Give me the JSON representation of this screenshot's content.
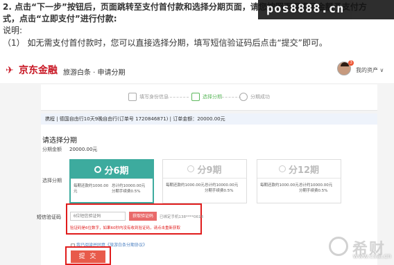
{
  "doc": {
    "line1": "2.   点击“下一步”按钮后，页面跳转至支付首付款和选择分期页面，请您按照页面提示金额予支付方",
    "line2": "式，点击“立即支付”进行付款:",
    "label": "说明:",
    "note": "（1）   如无需支付首付款时，您可以直接选择分期，填写短信验证码后点击“提交”即可。",
    "watermark": "pos8888.cn"
  },
  "header": {
    "logo_glyph": "✈",
    "brand": "京东金融",
    "subtitle": "旅游白条 · 申请分期",
    "badge": "3",
    "my_account": "我的资产 ∨"
  },
  "steps": [
    {
      "label": "填写身份信息"
    },
    {
      "label": "选择分期"
    },
    {
      "label": "分期成功"
    }
  ],
  "order": {
    "text": "携程 | 德国自由行10天9晚自由行(订单号 1720846871) | 订单金额：20000.00元"
  },
  "plan": {
    "section_title": "请选择分期",
    "amount_label": "分期金额",
    "amount_value": "20000.00元",
    "choose_label": "选择分期",
    "options": [
      {
        "label": "分6期",
        "monthly": "每期还款约1000.00元",
        "total": "总计约10000.00元",
        "fee": "分期手续费0.5%"
      },
      {
        "label": "分9期",
        "monthly": "每期还款约1000.00元",
        "total": "总计约10000.00元",
        "fee": "分期手续费0.5%"
      },
      {
        "label": "分12期",
        "monthly": "每期还款约1000.00元",
        "total": "总计约10000.00元",
        "fee": "分期手续费0.5%"
      }
    ]
  },
  "sms": {
    "label": "短信验证码",
    "placeholder": "6位短信验证码",
    "get_code": "获取验证码",
    "sent_to": "已绑定手机138****0618",
    "error": "验证码是6位数字，如果60秒内没有收到验证码，请点击重新获取"
  },
  "agree_text": "我已阅读并同意《旅游白条分期协议》",
  "submit_label": "提 交",
  "corner_watermark": {
    "brand": "希财",
    "url": "www.csai.cn"
  }
}
